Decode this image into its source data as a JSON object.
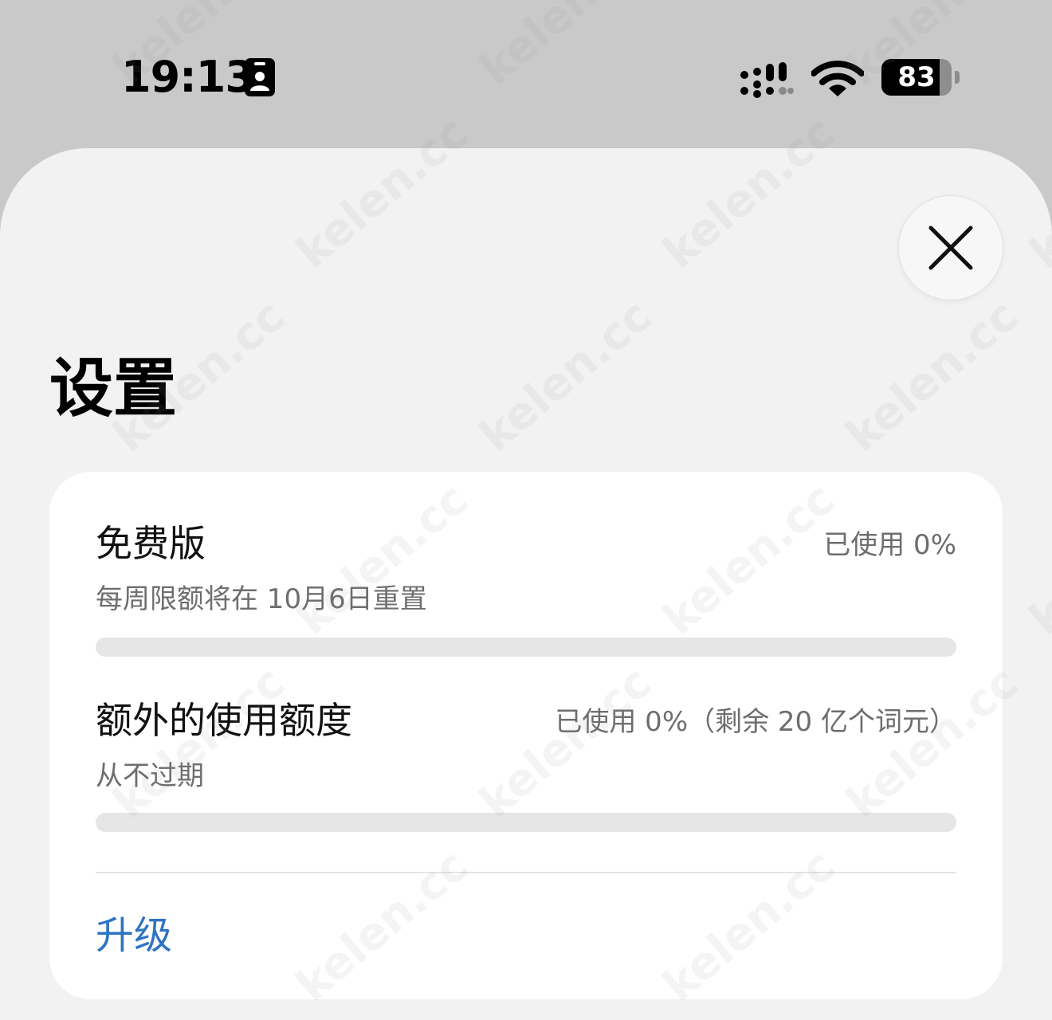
{
  "status_bar": {
    "time": "19:13",
    "battery_percent": 83,
    "battery_label": "83",
    "signal_icon": "cellular-signal-icon",
    "wifi_icon": "wifi-icon",
    "badge_icon": "id-badge-icon"
  },
  "header": {
    "title": "设置",
    "close_icon": "close-icon"
  },
  "plan": {
    "name": "免费版",
    "usage": "已使用 0%",
    "reset_note": "每周限额将在 10月6日重置",
    "progress": 0
  },
  "extra": {
    "name": "额外的使用额度",
    "usage": "已使用 0%（剩余 20 亿个词元）",
    "expiry_note": "从不过期",
    "progress": 0
  },
  "actions": {
    "upgrade_label": "升级"
  },
  "watermark": {
    "text": "kelen.cc"
  },
  "colors": {
    "sheet_background": "#f2f2f3",
    "card_background": "#ffffff",
    "link": "#2f73c3",
    "secondary_text": "#6e6e70",
    "track": "#e6e6e7"
  }
}
